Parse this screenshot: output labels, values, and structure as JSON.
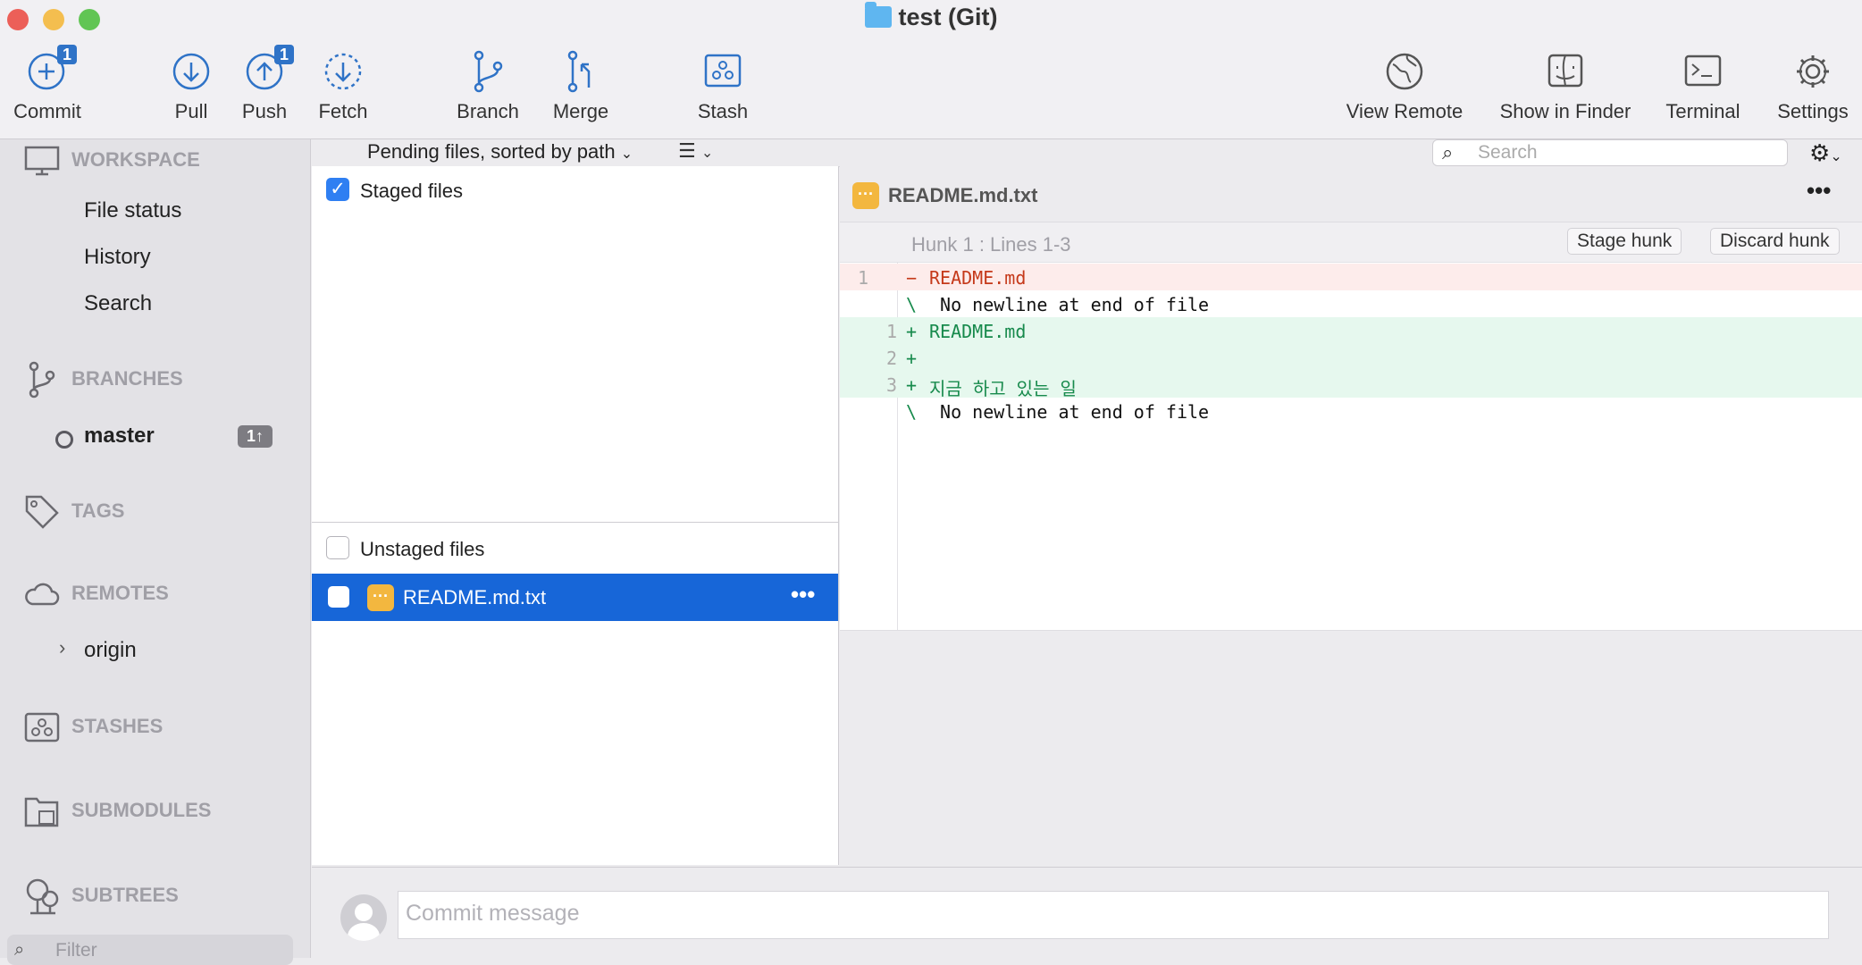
{
  "window": {
    "title": "test (Git)"
  },
  "toolbar": {
    "commit": {
      "label": "Commit",
      "badge": "1"
    },
    "pull": {
      "label": "Pull"
    },
    "push": {
      "label": "Push",
      "badge": "1"
    },
    "fetch": {
      "label": "Fetch"
    },
    "branch": {
      "label": "Branch"
    },
    "merge": {
      "label": "Merge"
    },
    "stash": {
      "label": "Stash"
    },
    "view_remote": {
      "label": "View Remote"
    },
    "show_in_finder": {
      "label": "Show in Finder"
    },
    "terminal": {
      "label": "Terminal"
    },
    "settings": {
      "label": "Settings"
    }
  },
  "sidebar": {
    "workspace": {
      "label": "WORKSPACE",
      "items": [
        "File status",
        "History",
        "Search"
      ]
    },
    "branches": {
      "label": "BRANCHES",
      "current": "master",
      "ahead_badge": "1↑"
    },
    "tags": {
      "label": "TAGS"
    },
    "remotes": {
      "label": "REMOTES",
      "items": [
        "origin"
      ]
    },
    "stashes": {
      "label": "STASHES"
    },
    "submodules": {
      "label": "SUBMODULES"
    },
    "subtrees": {
      "label": "SUBTREES"
    },
    "filter_placeholder": "Filter"
  },
  "files": {
    "sort_label": "Pending files, sorted by path",
    "search_placeholder": "Search",
    "staged_label": "Staged files",
    "unstaged_label": "Unstaged files",
    "unstaged_files": [
      {
        "name": "README.md.txt",
        "status": "modified"
      }
    ]
  },
  "diff": {
    "file_name": "README.md.txt",
    "hunk_title": "Hunk 1 : Lines 1-3",
    "stage_hunk_label": "Stage hunk",
    "discard_hunk_label": "Discard hunk",
    "lines": [
      {
        "old": "1",
        "new": "",
        "sign": "−",
        "text": "README.md",
        "kind": "removed"
      },
      {
        "old": "",
        "new": "",
        "sign": "\\",
        "text": " No newline at end of file",
        "kind": "meta"
      },
      {
        "old": "",
        "new": "1",
        "sign": "+",
        "text": "README.md",
        "kind": "added"
      },
      {
        "old": "",
        "new": "2",
        "sign": "+",
        "text": "",
        "kind": "added"
      },
      {
        "old": "",
        "new": "3",
        "sign": "+",
        "text": "지금 하고 있는 일",
        "kind": "added"
      },
      {
        "old": "",
        "new": "",
        "sign": "\\",
        "text": " No newline at end of file",
        "kind": "meta"
      }
    ]
  },
  "commit": {
    "placeholder": "Commit message"
  },
  "colors": {
    "accent": "#2f73c7",
    "selection": "#1766d8",
    "removed_bg": "#fdeceb",
    "added_bg": "#e6f8ee",
    "removed_text": "#c5391a",
    "added_text": "#178a4c",
    "modified_badge": "#f3b73f"
  }
}
